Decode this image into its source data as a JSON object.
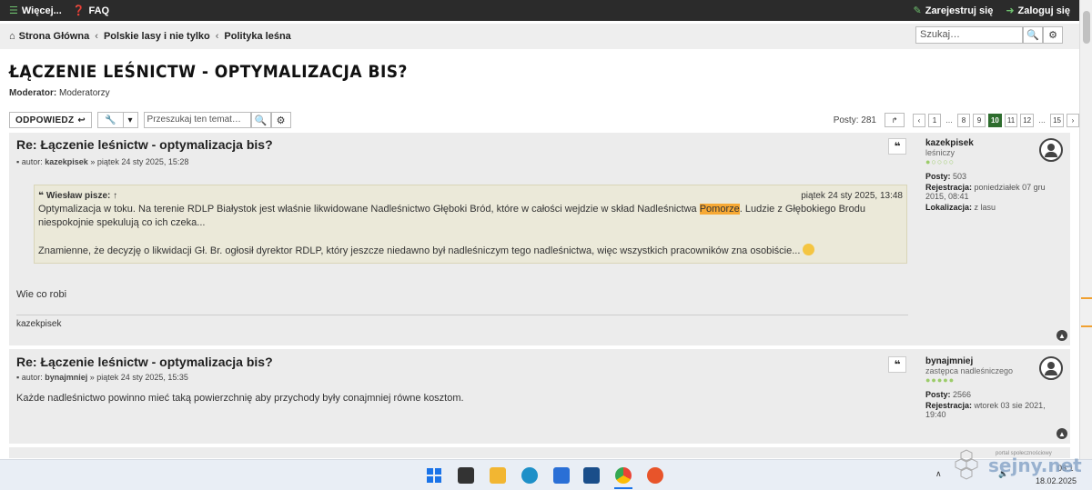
{
  "topbar": {
    "more": "Więcej...",
    "faq": "FAQ",
    "register": "Zarejestruj się",
    "login": "Zaloguj się"
  },
  "breadcrumb": {
    "home": "Strona Główna",
    "forum": "Polskie lasy i nie tylko",
    "subforum": "Polityka leśna"
  },
  "search": {
    "placeholder": "Szukaj…"
  },
  "topic": {
    "title": "ŁĄCZENIE LEŚNICTW - OPTYMALIZACJA BIS?",
    "moderator_label": "Moderator:",
    "moderator": "Moderatorzy"
  },
  "actions": {
    "reply": "ODPOWIEDZ",
    "topic_search_placeholder": "Przeszukaj ten temat…"
  },
  "pagination": {
    "posts_label": "Posty: 281",
    "pages": [
      "1",
      "…",
      "8",
      "9",
      "10",
      "11",
      "12",
      "…",
      "15"
    ],
    "current": "10"
  },
  "posts": [
    {
      "title": "Re: Łączenie leśnictw - optymalizacja bis?",
      "author_prefix": "autor:",
      "author": "kazekpisek",
      "date": "» piątek 24 sty 2025, 15:28",
      "quote": {
        "who": "Wiesław pisze: ↑",
        "date": "piątek 24 sty 2025, 13:48",
        "p1_a": "Optymalizacja w toku. Na terenie RDLP Białystok jest właśnie likwidowane Nadleśnictwo Głęboki Bród, które w całości wejdzie w skład Nadleśnictwa ",
        "p1_hl": "Pomorze",
        "p1_b": ". Ludzie z Głębokiego Brodu niespokojnie spekulują co ich czeka...",
        "p2": "Znamienne, że decyzję o likwidacji Gł. Br. ogłosił dyrektor RDLP, który jeszcze niedawno był nadleśniczym tego nadleśnictwa, więc wszystkich pracowników zna osobiście..."
      },
      "body": "Wie co robi",
      "signature": "kazekpisek",
      "profile": {
        "username": "kazekpisek",
        "rank": "leśniczy",
        "posts_label": "Posty:",
        "posts": "503",
        "reg_label": "Rejestracja:",
        "reg": "poniedziałek 07 gru 2015, 08:41",
        "loc_label": "Lokalizacja:",
        "loc": "z lasu"
      }
    },
    {
      "title": "Re: Łączenie leśnictw - optymalizacja bis?",
      "author_prefix": "autor:",
      "author": "bynajmniej",
      "date": "» piątek 24 sty 2025, 15:35",
      "body": "Każde nadleśnictwo powinno mieć taką powierzchnię aby przychody były conajmniej równe kosztom.",
      "profile": {
        "username": "bynajmniej",
        "rank": "zastępca nadleśniczego",
        "posts_label": "Posty:",
        "posts": "2566",
        "reg_label": "Rejestracja:",
        "reg": "wtorek 03 sie 2021, 19:40"
      }
    }
  ],
  "taskbar": {
    "time": "08:1",
    "date": "18.02.2025"
  },
  "watermark": {
    "small": "portal społecznościowy",
    "big": "sejny.net"
  },
  "colors": {
    "accent": "#2e6d2e",
    "topbar": "#2b2b2b",
    "highlight": "#f7a934"
  }
}
